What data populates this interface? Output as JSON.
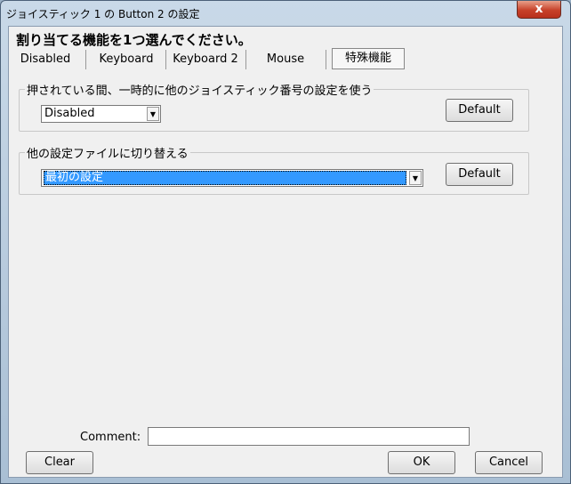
{
  "window": {
    "title": "ジョイスティック 1 の Button 2 の設定",
    "close_label": "x"
  },
  "instruction": "割り当てる機能を1つ選んでください。",
  "tabs": [
    {
      "label": "Disabled"
    },
    {
      "label": "Keyboard"
    },
    {
      "label": "Keyboard 2"
    },
    {
      "label": "Mouse"
    },
    {
      "label": "特殊機能",
      "active": true
    }
  ],
  "group1": {
    "legend": "押されている間、一時的に他のジョイスティック番号の設定を使う",
    "select_value": "Disabled",
    "default_label": "Default"
  },
  "group2": {
    "legend": "他の設定ファイルに切り替える",
    "select_value": "最初の設定",
    "default_label": "Default"
  },
  "comment": {
    "label": "Comment:",
    "value": ""
  },
  "buttons": {
    "clear": "Clear",
    "ok": "OK",
    "cancel": "Cancel"
  },
  "colors": {
    "selection": "#3399ff",
    "close": "#c7412a"
  }
}
